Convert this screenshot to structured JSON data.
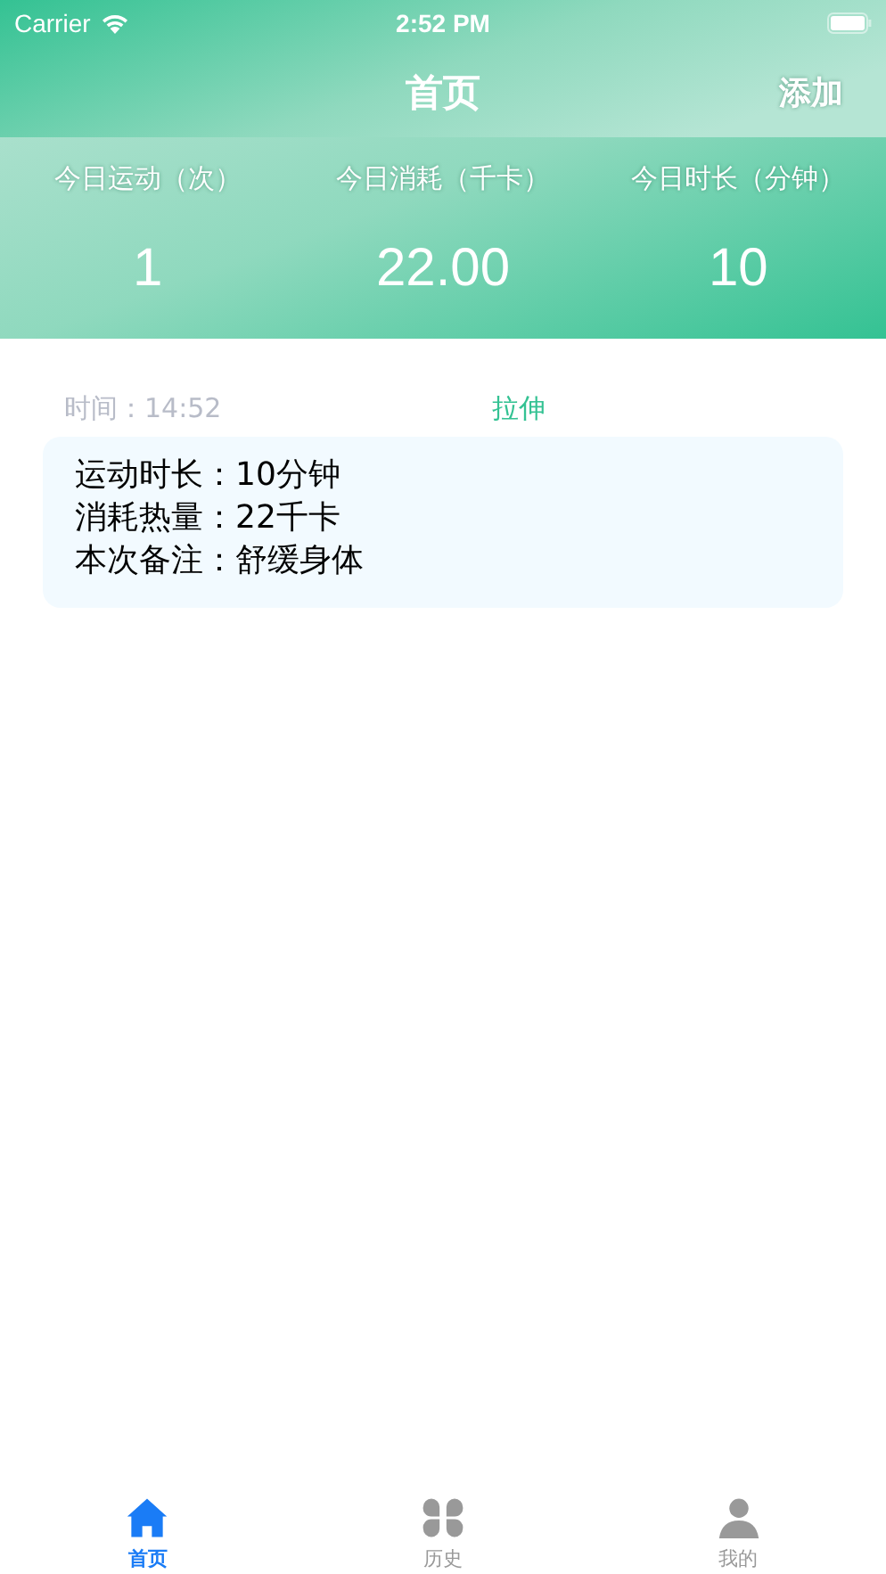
{
  "status_bar": {
    "carrier": "Carrier",
    "time": "2:52 PM"
  },
  "nav": {
    "title": "首页",
    "action": "添加"
  },
  "stats": [
    {
      "label": "今日运动（次）",
      "value": "1"
    },
    {
      "label": "今日消耗（千卡）",
      "value": "22.00"
    },
    {
      "label": "今日时长（分钟）",
      "value": "10"
    }
  ],
  "records": [
    {
      "time": "时间：14:52",
      "type": "拉伸",
      "lines": [
        "运动时长：10分钟",
        "消耗热量：22千卡",
        "本次备注：舒缓身体"
      ]
    }
  ],
  "tabs": [
    {
      "label": "首页",
      "kind": "home",
      "selected": true
    },
    {
      "label": "历史",
      "kind": "grid",
      "selected": false
    },
    {
      "label": "我的",
      "kind": "person",
      "selected": false
    }
  ]
}
